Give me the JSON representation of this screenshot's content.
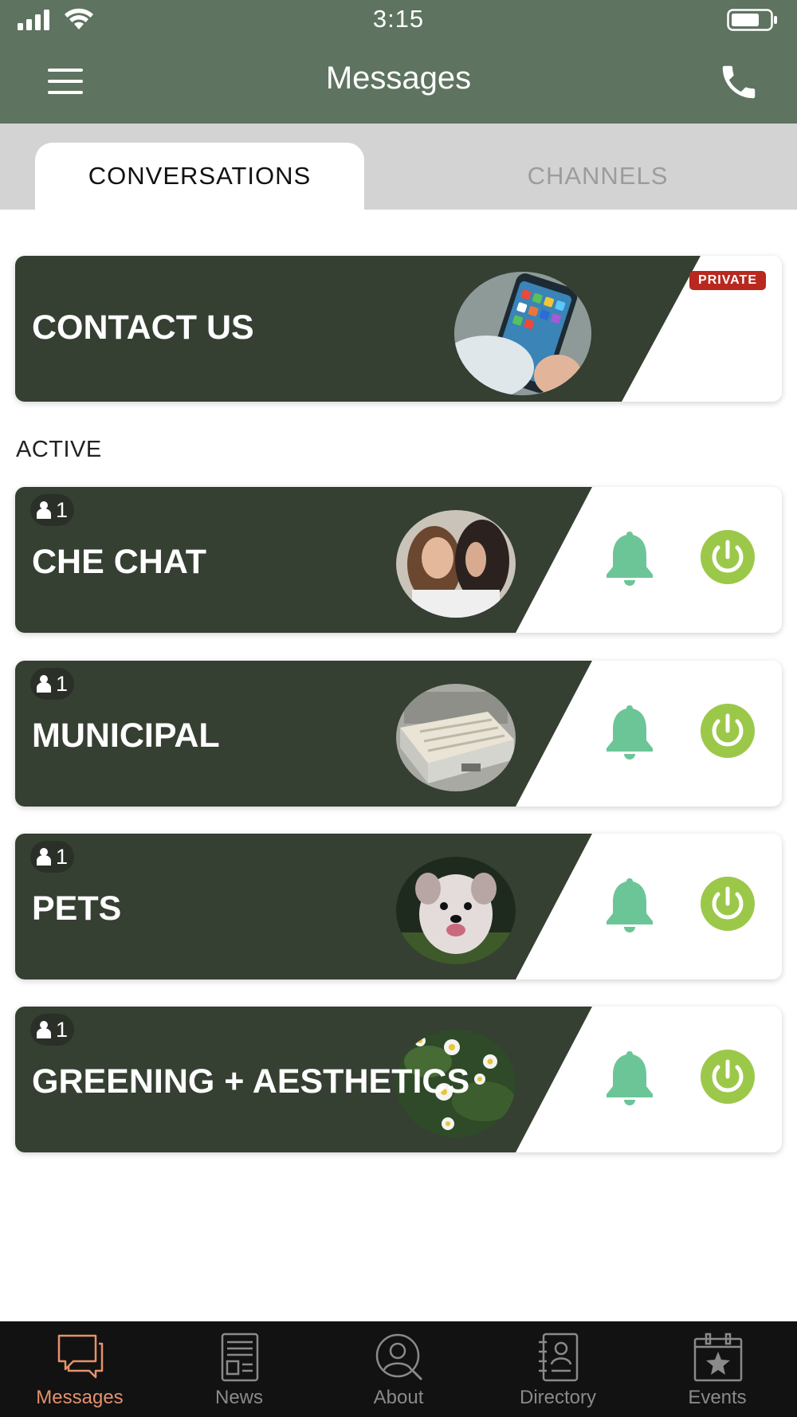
{
  "status_bar": {
    "time": "3:15"
  },
  "header": {
    "title": "Messages"
  },
  "tabs": [
    {
      "label": "CONVERSATIONS",
      "active": true
    },
    {
      "label": "CHANNELS",
      "active": false
    }
  ],
  "contact_card": {
    "title": "CONTACT US",
    "badge": "PRIVATE"
  },
  "section_label": "ACTIVE",
  "conversations": [
    {
      "title": "CHE CHAT",
      "members": "1"
    },
    {
      "title": "MUNICIPAL",
      "members": "1"
    },
    {
      "title": "PETS",
      "members": "1"
    },
    {
      "title": "GREENING + AESTHETICS",
      "members": "1"
    }
  ],
  "bottom_nav": [
    {
      "label": "Messages",
      "icon": "chat-bubbles-icon",
      "active": true
    },
    {
      "label": "News",
      "icon": "newspaper-icon",
      "active": false
    },
    {
      "label": "About",
      "icon": "profile-search-icon",
      "active": false
    },
    {
      "label": "Directory",
      "icon": "address-book-icon",
      "active": false
    },
    {
      "label": "Events",
      "icon": "calendar-star-icon",
      "active": false
    }
  ],
  "colors": {
    "header_bg": "#5e7360",
    "card_dark": "#353f32",
    "bell": "#6cc597",
    "power": "#9cc84a",
    "private_badge": "#b8281f",
    "nav_active": "#e5916b"
  }
}
